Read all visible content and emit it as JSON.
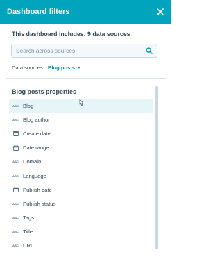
{
  "header": {
    "title": "Dashboard filters"
  },
  "summary": "This dashboard includes: 9 data sources",
  "search": {
    "placeholder": "Search across sources",
    "value": ""
  },
  "data_sources": {
    "label": "Data sources:",
    "selected": "Blog posts"
  },
  "section": {
    "title": "Blog posts properties"
  },
  "properties": [
    {
      "label": "Blog",
      "type": "text"
    },
    {
      "label": "Blog author",
      "type": "text"
    },
    {
      "label": "Create date",
      "type": "date"
    },
    {
      "label": "Date range",
      "type": "date"
    },
    {
      "label": "Domain",
      "type": "text"
    },
    {
      "label": "Language",
      "type": "text"
    },
    {
      "label": "Publish date",
      "type": "date"
    },
    {
      "label": "Publish status",
      "type": "text"
    },
    {
      "label": "Tags",
      "type": "text"
    },
    {
      "label": "Title",
      "type": "text"
    },
    {
      "label": "URL",
      "type": "text"
    }
  ],
  "type_icon_text": "ABC",
  "colors": {
    "header": "#00a4bd",
    "link": "#0091ae",
    "active_row": "#e5f5f8"
  }
}
